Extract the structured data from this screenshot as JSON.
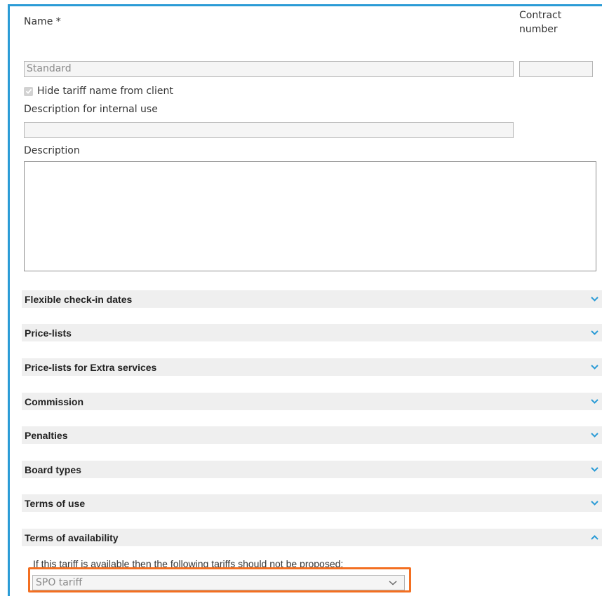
{
  "form": {
    "name_label": "Name *",
    "name_value": "Standard",
    "contract_label": "Contract number",
    "contract_value": "",
    "hide_label": "Hide tariff name from client",
    "hide_checked": true,
    "desc_internal_label": "Description for internal use",
    "desc_internal_value": "",
    "description_label": "Description",
    "description_value": ""
  },
  "sections": [
    {
      "label": "Flexible check-in dates",
      "expanded": false
    },
    {
      "label": "Price-lists",
      "expanded": false
    },
    {
      "label": "Price-lists for Extra services",
      "expanded": false
    },
    {
      "label": "Commission",
      "expanded": false
    },
    {
      "label": "Penalties",
      "expanded": false
    },
    {
      "label": "Board types",
      "expanded": false
    },
    {
      "label": "Terms of use",
      "expanded": false
    },
    {
      "label": "Terms of availability",
      "expanded": true
    }
  ],
  "availability": {
    "text": "If this tariff is available then the following tariffs should not be proposed:",
    "selected": "SPO tariff"
  },
  "colors": {
    "accent": "#2a9bd6",
    "highlight": "#f36f21",
    "section_bg": "#efefef"
  },
  "icons": {
    "collapsed": "chevron-down-icon",
    "expanded": "chevron-up-icon",
    "select": "dropdown-arrow-icon"
  }
}
